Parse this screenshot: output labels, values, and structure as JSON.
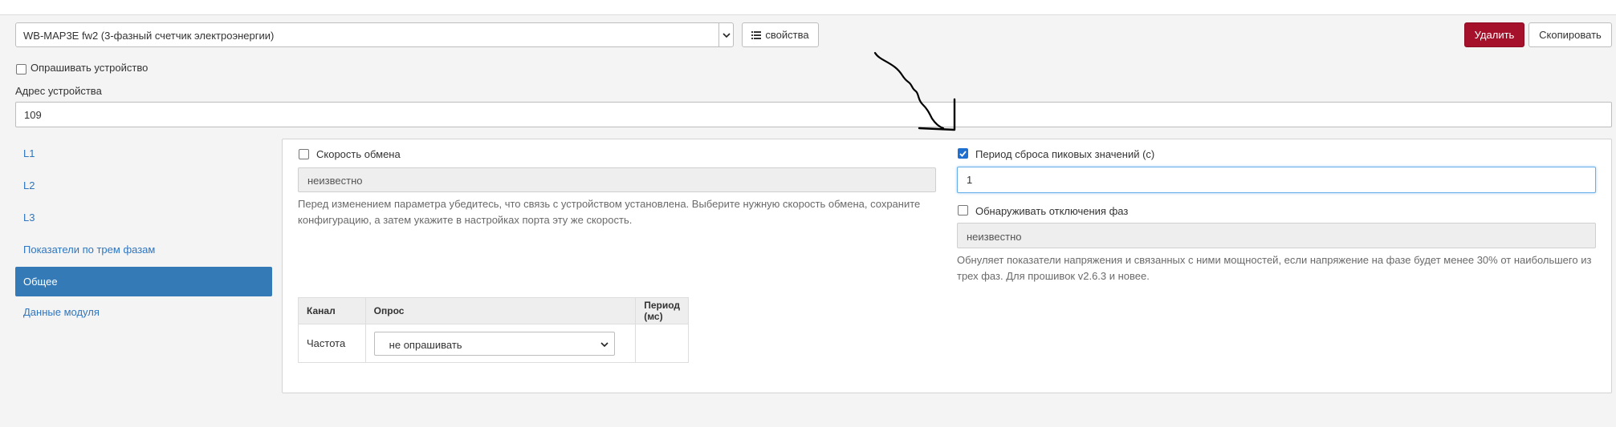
{
  "device_select": {
    "value": "WB-MAP3E fw2 (3-фазный счетчик электроэнергии)"
  },
  "toolbar": {
    "properties_label": "свойства",
    "delete_label": "Удалить",
    "copy_label": "Скопировать"
  },
  "poll_device": {
    "label": "Опрашивать устройство",
    "checked": false
  },
  "address": {
    "label": "Адрес устройства",
    "value": "109"
  },
  "sidebar": {
    "items": [
      {
        "label": "L1",
        "active": false
      },
      {
        "label": "L2",
        "active": false
      },
      {
        "label": "L3",
        "active": false
      },
      {
        "label": "Показатели по трем фазам",
        "active": false
      },
      {
        "label": "Общее",
        "active": true
      },
      {
        "label": "Данные модуля",
        "active": false
      }
    ]
  },
  "baud": {
    "label": "Скорость обмена",
    "checked": false,
    "value": "неизвестно",
    "help": "Перед изменением параметра убедитесь, что связь с устройством установлена. Выберите нужную скорость обмена, сохраните конфигурацию, а затем укажите в настройках порта эту же скорость."
  },
  "peak_reset": {
    "label": "Период сброса пиковых значений (с)",
    "checked": true,
    "value": "1"
  },
  "phase_loss": {
    "label": "Обнаруживать отключения фаз",
    "checked": false,
    "value": "неизвестно",
    "help": "Обнуляет показатели напряжения и связанных с ними мощностей, если напряжение на фазе будет менее 30% от наибольшего из трех фаз. Для прошивок v2.6.3 и новее."
  },
  "channels_table": {
    "headers": [
      "Канал",
      "Опрос",
      "Период (мс)"
    ],
    "rows": [
      {
        "channel": "Частота",
        "poll": "не опрашивать",
        "period": ""
      }
    ]
  },
  "colors": {
    "accent": "#337ab7",
    "danger": "#a5102a",
    "focus": "#66afe9"
  },
  "icons": {
    "properties": "list-icon",
    "dropdown": "chevron-down-icon",
    "annotation": "hand-drawn-arrow-icon"
  }
}
